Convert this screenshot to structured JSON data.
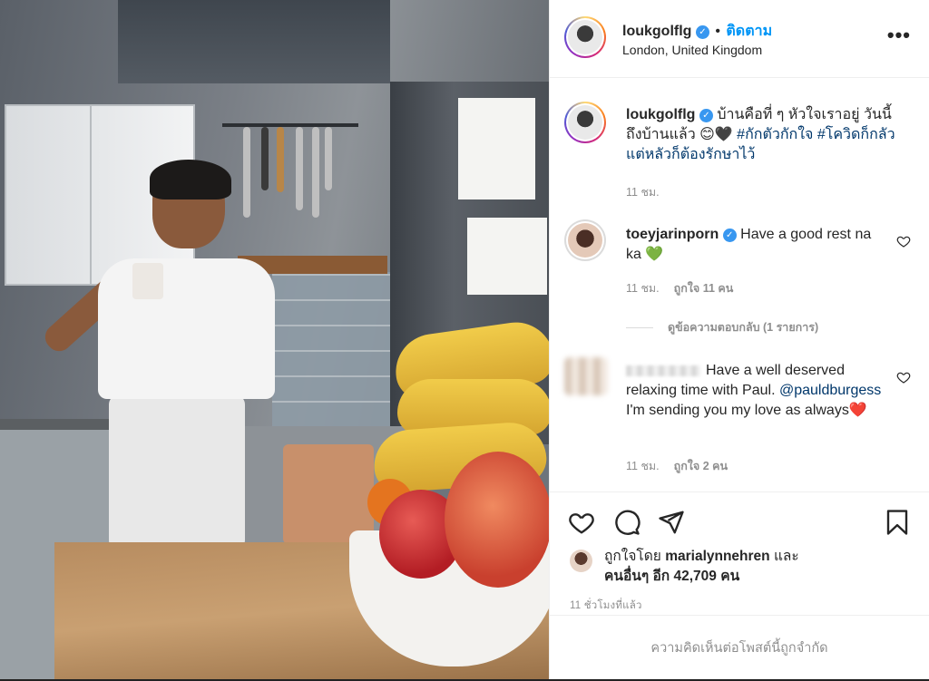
{
  "post": {
    "username": "loukgolflg",
    "follow_label": "ติดตาม",
    "location": "London, United Kingdom",
    "more_label": "•••",
    "caption": {
      "username": "loukgolflg",
      "text": "บ้านคือที่ ๆ หัวใจเราอยู่ วันนี้ถึงบ้านแล้ว 😊🖤 ",
      "hashtags": "#กักตัวกักใจ #โควิดก็กลัวแต่หลัวก็ต้องรักษาไว้",
      "time": "11 ชม."
    },
    "comments": [
      {
        "username": "toeyjarinporn",
        "text": "Have a good rest na ka 💚",
        "time": "11 ชม.",
        "likes": "ถูกใจ 11 คน",
        "view_replies": "ดูข้อความตอบกลับ (1 รายการ)"
      },
      {
        "text": "Have a well deserved relaxing time with Paul. ",
        "mention": "@pauldburgess",
        "text_after": " I'm sending you my love as always❤️",
        "time": "11 ชม.",
        "likes": "ถูกใจ 2 คน"
      }
    ],
    "liked_by_prefix": "ถูกใจโดย ",
    "liked_by_user": "marialynnehren",
    "liked_by_and": " และ",
    "liked_by_others": "คนอื่นๆ อีก 42,709 คน",
    "timestamp": "11 ชั่วโมงที่แล้ว",
    "comments_limited": "ความคิดเห็นต่อโพสต์นี้ถูกจำกัด"
  },
  "icons": [
    "verified-badge-icon",
    "more-options-icon",
    "heart-icon",
    "comment-icon",
    "share-icon",
    "bookmark-icon"
  ],
  "colors": {
    "link": "#0095f6",
    "hashtag": "#00376b",
    "muted": "#8e8e8e",
    "verified": "#3897f0"
  }
}
